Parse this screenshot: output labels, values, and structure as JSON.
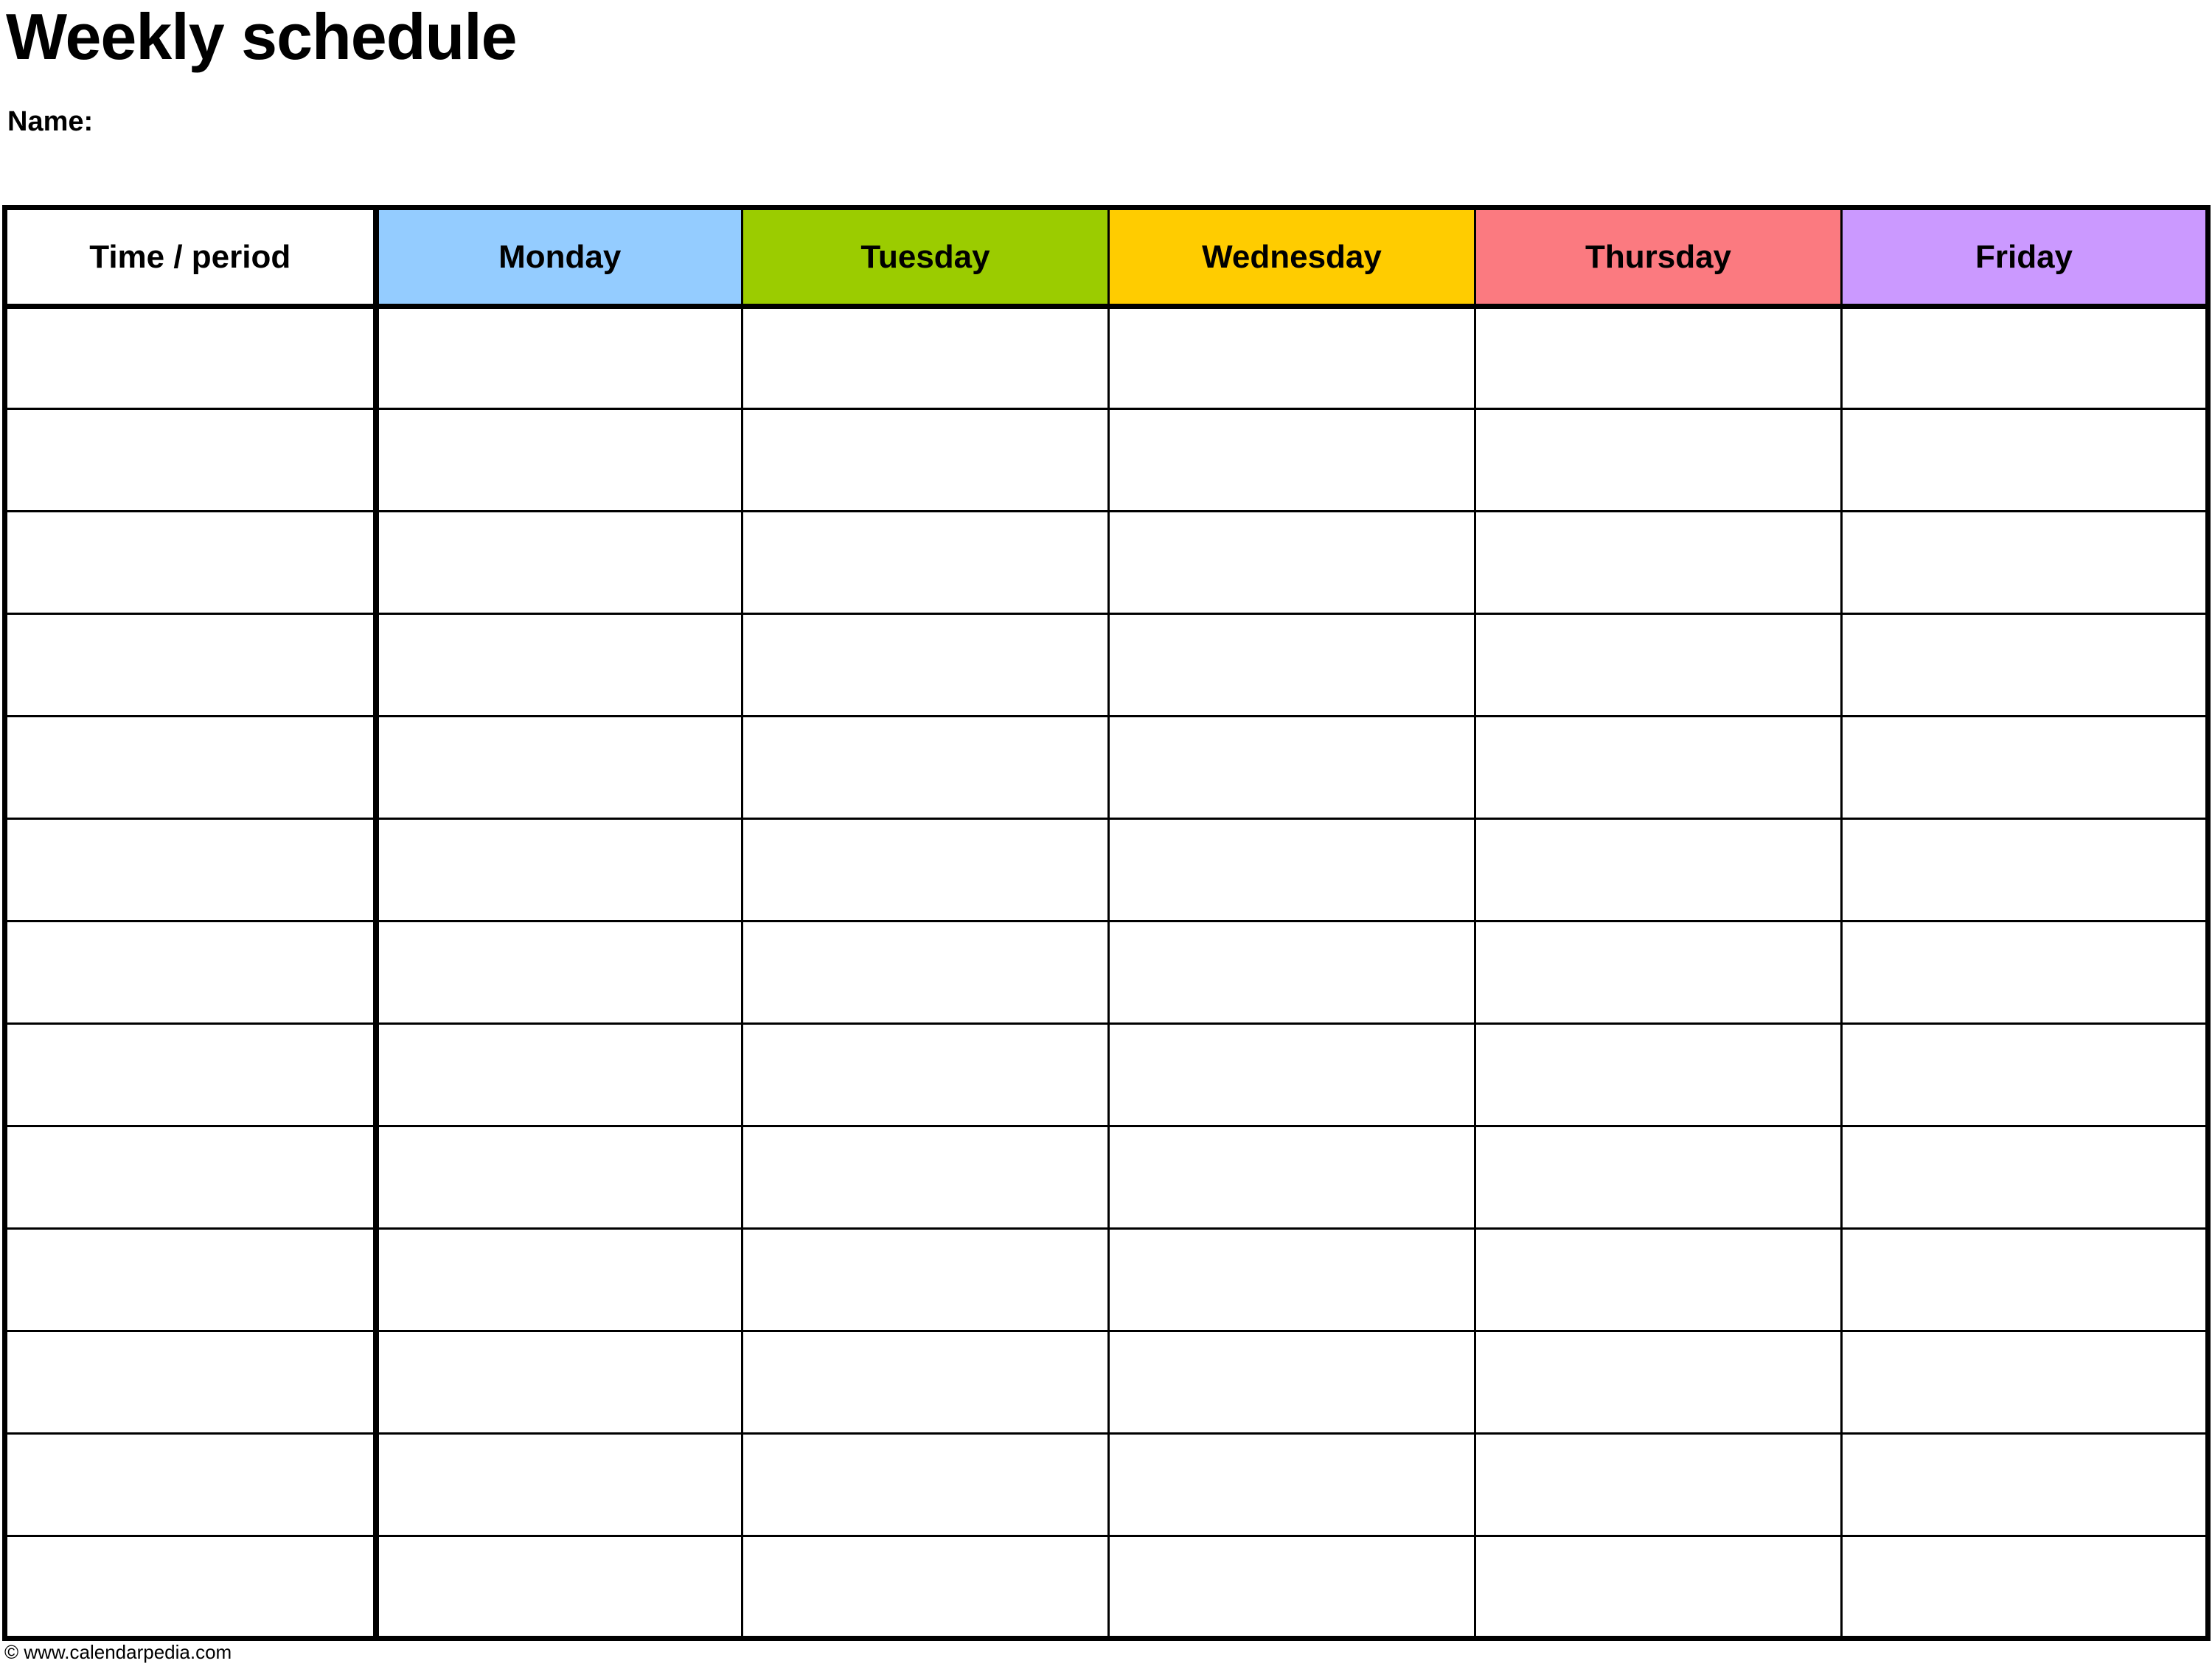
{
  "document": {
    "title": "Weekly schedule",
    "name_label": "Name:"
  },
  "table": {
    "columns": [
      {
        "label": "Time / period",
        "color": "#ffffff",
        "is_day": false
      },
      {
        "label": "Monday",
        "color": "#94ccff",
        "is_day": true
      },
      {
        "label": "Tuesday",
        "color": "#9bcc00",
        "is_day": true
      },
      {
        "label": "Wednesday",
        "color": "#ffcc00",
        "is_day": true
      },
      {
        "label": "Thursday",
        "color": "#fb7a80",
        "is_day": true
      },
      {
        "label": "Friday",
        "color": "#cb99ff",
        "is_day": true
      }
    ],
    "row_count": 13,
    "rows": [
      {
        "time": "",
        "monday": "",
        "tuesday": "",
        "wednesday": "",
        "thursday": "",
        "friday": ""
      },
      {
        "time": "",
        "monday": "",
        "tuesday": "",
        "wednesday": "",
        "thursday": "",
        "friday": ""
      },
      {
        "time": "",
        "monday": "",
        "tuesday": "",
        "wednesday": "",
        "thursday": "",
        "friday": ""
      },
      {
        "time": "",
        "monday": "",
        "tuesday": "",
        "wednesday": "",
        "thursday": "",
        "friday": ""
      },
      {
        "time": "",
        "monday": "",
        "tuesday": "",
        "wednesday": "",
        "thursday": "",
        "friday": ""
      },
      {
        "time": "",
        "monday": "",
        "tuesday": "",
        "wednesday": "",
        "thursday": "",
        "friday": ""
      },
      {
        "time": "",
        "monday": "",
        "tuesday": "",
        "wednesday": "",
        "thursday": "",
        "friday": ""
      },
      {
        "time": "",
        "monday": "",
        "tuesday": "",
        "wednesday": "",
        "thursday": "",
        "friday": ""
      },
      {
        "time": "",
        "monday": "",
        "tuesday": "",
        "wednesday": "",
        "thursday": "",
        "friday": ""
      },
      {
        "time": "",
        "monday": "",
        "tuesday": "",
        "wednesday": "",
        "thursday": "",
        "friday": ""
      },
      {
        "time": "",
        "monday": "",
        "tuesday": "",
        "wednesday": "",
        "thursday": "",
        "friday": ""
      },
      {
        "time": "",
        "monday": "",
        "tuesday": "",
        "wednesday": "",
        "thursday": "",
        "friday": ""
      },
      {
        "time": "",
        "monday": "",
        "tuesday": "",
        "wednesday": "",
        "thursday": "",
        "friday": ""
      }
    ]
  },
  "footer": {
    "credit": "© www.calendarpedia.com"
  }
}
